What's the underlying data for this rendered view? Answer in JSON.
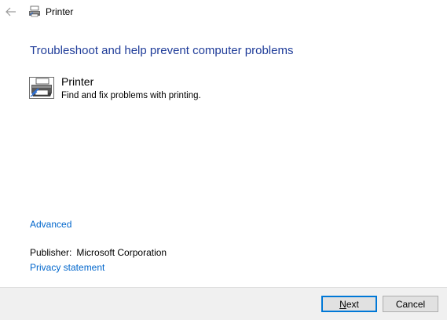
{
  "titlebar": {
    "title": "Printer",
    "back_icon": "arrow-left-icon",
    "app_icon": "printer-icon"
  },
  "main": {
    "heading": "Troubleshoot and help prevent computer problems",
    "item": {
      "icon": "printer-icon",
      "title": "Printer",
      "description": "Find and fix problems with printing."
    },
    "advanced_label": "Advanced",
    "publisher_label": "Publisher:",
    "publisher_value": "Microsoft Corporation",
    "privacy_label": "Privacy statement"
  },
  "footer": {
    "next_label": "Next",
    "cancel_label": "Cancel"
  },
  "colors": {
    "heading": "#1f3c99",
    "link": "#0066cc",
    "footer_bg": "#f0f0f0",
    "default_button_border": "#0078d7"
  }
}
